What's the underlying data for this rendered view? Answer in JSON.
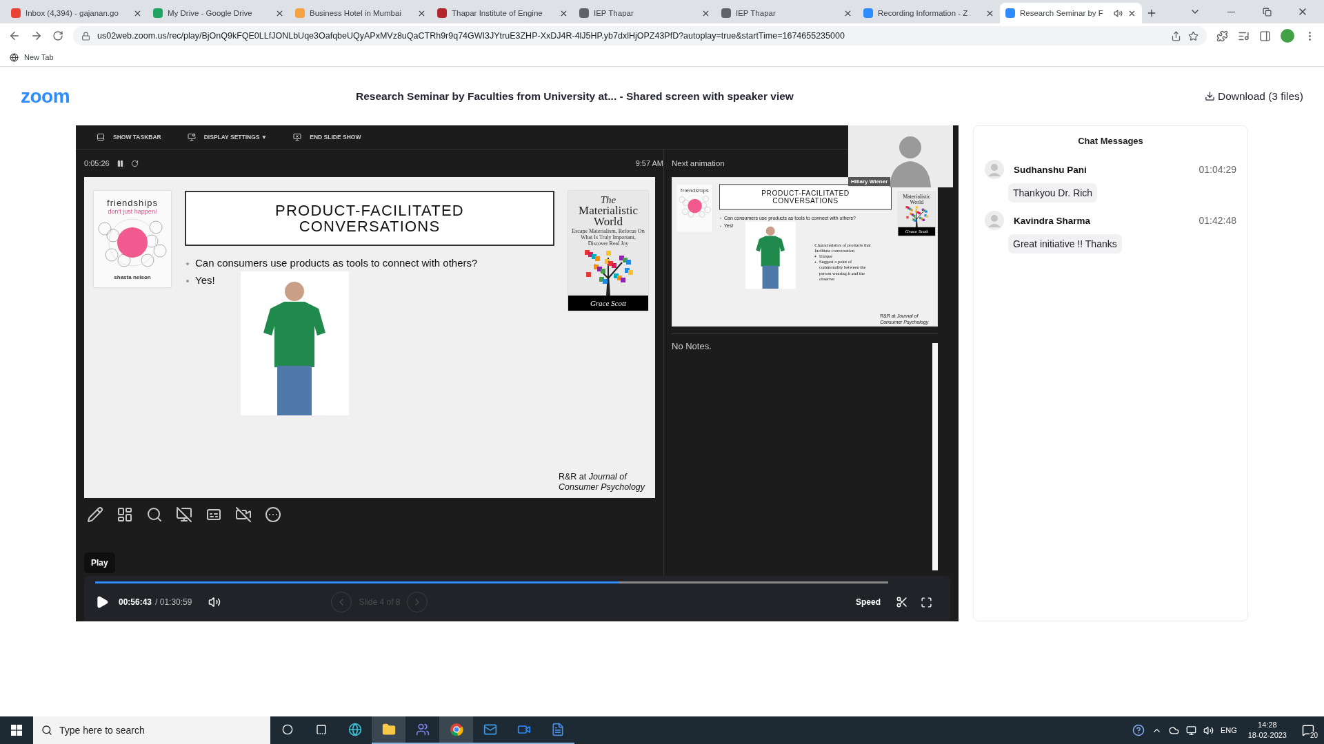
{
  "browser": {
    "tabs": [
      {
        "title": "Inbox (4,394) - gajanan.go",
        "color": "#ea4335",
        "selected": false
      },
      {
        "title": "My Drive - Google Drive",
        "color": "#1fa463",
        "selected": false
      },
      {
        "title": "Business Hotel in Mumbai",
        "color": "#f4a340",
        "selected": false
      },
      {
        "title": "Thapar Institute of Engine",
        "color": "#b3262b",
        "selected": false
      },
      {
        "title": "IEP Thapar",
        "color": "#5f6368",
        "selected": false
      },
      {
        "title": "IEP Thapar",
        "color": "#5f6368",
        "selected": false
      },
      {
        "title": "Recording Information - Z",
        "color": "#2d8cff",
        "selected": false
      },
      {
        "title": "Research Seminar by F",
        "color": "#2d8cff",
        "selected": true
      }
    ],
    "url": "us02web.zoom.us/rec/play/BjOnQ9kFQE0LLfJONLbUqe3OafqbeUQyAPxMVz8uQaCTRh9r9q74GWI3JYtruE3ZHP-XxDJ4R-4lJ5HP.yb7dxlHjOPZ43PfD?autoplay=true&startTime=1674655235000",
    "bookmarks": [
      "New Tab"
    ]
  },
  "header": {
    "logo": "zoom",
    "title": "Research Seminar by Faculties from University at... - Shared screen with speaker view",
    "download": "Download (3 files)"
  },
  "player": {
    "slideshow_toolbar": [
      {
        "kind": "taskbar",
        "label": "SHOW TASKBAR"
      },
      {
        "kind": "display",
        "label": "DISPLAY SETTINGS ▼"
      },
      {
        "kind": "end",
        "label": "END SLIDE SHOW"
      }
    ],
    "elapsed": "0:05:26",
    "clock": "9:57 AM",
    "slide": {
      "left_cover": {
        "title": "friendships",
        "subtitle": "don't just happen!",
        "author": "shasta nelson"
      },
      "title": "PRODUCT-FACILITATED CONVERSATIONS",
      "bullets": [
        "Can consumers use products as tools to connect with others?",
        "Yes!"
      ],
      "right_cover": {
        "pre_title": "The",
        "title": "Materialistic World",
        "subtitle": "Escape Materialism, Refocus On What Is Truly Important, Discover Real Joy",
        "author": "Grace Scott"
      },
      "footer": "R&R at *Journal of Consumer Psychology*"
    },
    "next_label": "Next animation",
    "next_slide": {
      "left_cover": {
        "title": "friendships"
      },
      "title": "PRODUCT-FACILITATED CONVERSATIONS",
      "bullets": [
        "Can consumers use products as tools to connect with others?",
        "Yes!"
      ],
      "characteristics": {
        "heading": "Characteristics of products that facilitate conversation",
        "items": [
          "Unique",
          "Suggest a point of commonality between the person wearing it and the observer"
        ]
      },
      "right_cover": {
        "title": "Materialistic World",
        "author": "Grace Scott"
      },
      "footer": "R&R at *Journal of Consumer Psychology*"
    },
    "speaker": {
      "name": "Hillary Wiener"
    },
    "notes": "No Notes.",
    "tooltip": "Play",
    "progress": {
      "level": 0.66
    },
    "current_time": "00:56:43",
    "duration": "/ 01:30:59",
    "slide_counter": "Slide 4 of 8",
    "speed": "Speed"
  },
  "chat": {
    "title": "Chat Messages",
    "messages": [
      {
        "name": "Sudhanshu Pani",
        "time": "01:04:29",
        "text": "Thankyou Dr. Rich"
      },
      {
        "name": "Kavindra Sharma",
        "time": "01:42:48",
        "text": "Great initiative !! Thanks"
      }
    ]
  },
  "taskbar": {
    "search_placeholder": "Type here to search",
    "language": "ENG",
    "time": "14:28",
    "date": "18-02-2023",
    "notifications": "20"
  }
}
